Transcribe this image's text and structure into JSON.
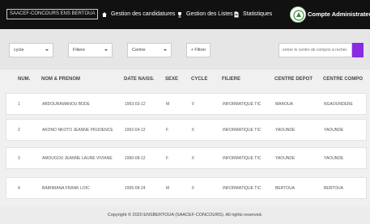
{
  "navbar": {
    "brand": "SAACEF-CONCOURS ENS BERTOUA",
    "links": [
      {
        "label": "Gestion des candidatures",
        "icon": "home-icon"
      },
      {
        "label": "Gestion des Listes",
        "icon": "trophy-icon"
      },
      {
        "label": "Statistiques",
        "icon": "document-icon"
      }
    ],
    "account_label": "Compte Administrateur"
  },
  "filters": {
    "cycle": "cycle",
    "filiere": "Filiere",
    "centre": "Centre",
    "filter_label": "+ Filtrer",
    "search_placeholder": "entrer le centre de compos à recher..."
  },
  "table": {
    "columns": [
      "NUM.",
      "NOM & PRENOM",
      "DATE NAISS.",
      "SEXE",
      "CYCLE",
      "FILIERE",
      "CENTRE DEPOT",
      "CENTRE COMPO"
    ],
    "rows": [
      [
        "1",
        "ABDOURAMANOU BODE",
        "1993-03-12",
        "M",
        "II",
        "INFORMATIQUE TIC",
        "MAROUA",
        "NGAOUNDERE"
      ],
      [
        "2",
        "AKONO NKOTO JEANNE PRUDENCE",
        "1992-04-12",
        "F",
        "II",
        "INFORMATIQUE TIC",
        "YAOUNDE",
        "YAOUNDE"
      ],
      [
        "3",
        "AMOUGOU JEANNE LAURE VIVIANE",
        "1990-08-12",
        "F",
        "II",
        "INFORMATIQUE TIC",
        "YAOUNDE",
        "YAOUNDE"
      ],
      [
        "4",
        "BAIRIMANA FRANK LOIC",
        "1995-08-24",
        "M",
        "II",
        "INFORMATIQUE TIC",
        "BERTOUA",
        "BERTOUA"
      ]
    ]
  },
  "footer": {
    "text": "Copyright © 2020 ENSBERTOUA (SAACEF-CONCOURS). All rights reserved."
  },
  "colors": {
    "navbar_bg": "#111111",
    "accent": "#8a2be2"
  }
}
